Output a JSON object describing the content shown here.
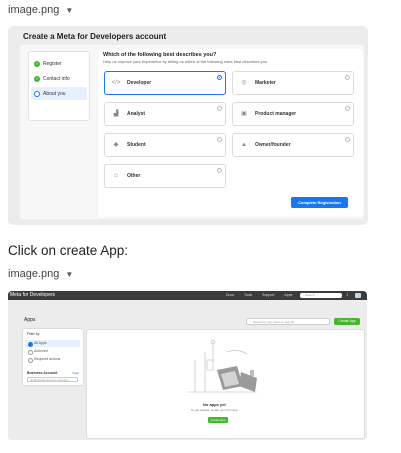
{
  "caption1": {
    "filename": "image.png",
    "icon": "triangle-down-icon"
  },
  "screen1": {
    "title": "Create a Meta for Developers account",
    "steps": [
      "Register",
      "Contact info",
      "About you"
    ],
    "question": "Which of the following best describes you?",
    "question_sub": "Help us improve your experience by telling us which of the following roles best describes you.",
    "options": [
      {
        "label": "Developer",
        "icon": "code-icon",
        "selected": true
      },
      {
        "label": "Marketer",
        "icon": "target-icon",
        "selected": false
      },
      {
        "label": "Analyst",
        "icon": "chart-icon",
        "selected": false
      },
      {
        "label": "Product manager",
        "icon": "briefcase-icon",
        "selected": false
      },
      {
        "label": "Student",
        "icon": "graduation-cap-icon",
        "selected": false
      },
      {
        "label": "Owner/founder",
        "icon": "building-icon",
        "selected": false
      },
      {
        "label": "Other",
        "icon": "person-icon",
        "selected": false
      }
    ],
    "complete_button": "Complete Registration",
    "accent_color": "#1877f2"
  },
  "instruction": "Click on create App:",
  "caption2": {
    "filename": "image.png",
    "icon": "triangle-down-icon"
  },
  "screen2": {
    "brand": "Meta for Developers",
    "nav": [
      "Docs",
      "Tools",
      "Support",
      "Apps"
    ],
    "search_placeholder": "Search",
    "page_title": "Apps",
    "apps_search_placeholder": "Search by app name or app ID",
    "create_button": "Create App",
    "filter": {
      "heading": "Filter by",
      "items": [
        "All Apps",
        "Archived",
        "Required actions"
      ],
      "business_account": "Business Account",
      "clear": "Clear",
      "dropdown": "No Business Account selected"
    },
    "empty_title": "No apps yet",
    "empty_sub": "To get started, create your first app.",
    "empty_button": "Create App",
    "green_color": "#42b72a"
  }
}
